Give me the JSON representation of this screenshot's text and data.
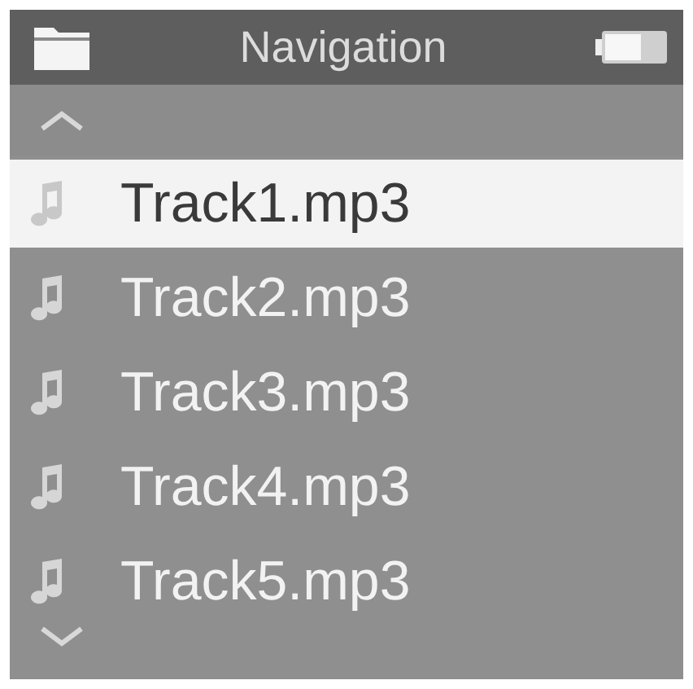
{
  "header": {
    "title": "Navigation"
  },
  "tracks": [
    {
      "name": "Track1.mp3",
      "selected": true
    },
    {
      "name": "Track2.mp3",
      "selected": false
    },
    {
      "name": "Track3.mp3",
      "selected": false
    },
    {
      "name": "Track4.mp3",
      "selected": false
    },
    {
      "name": "Track5.mp3",
      "selected": false
    }
  ]
}
